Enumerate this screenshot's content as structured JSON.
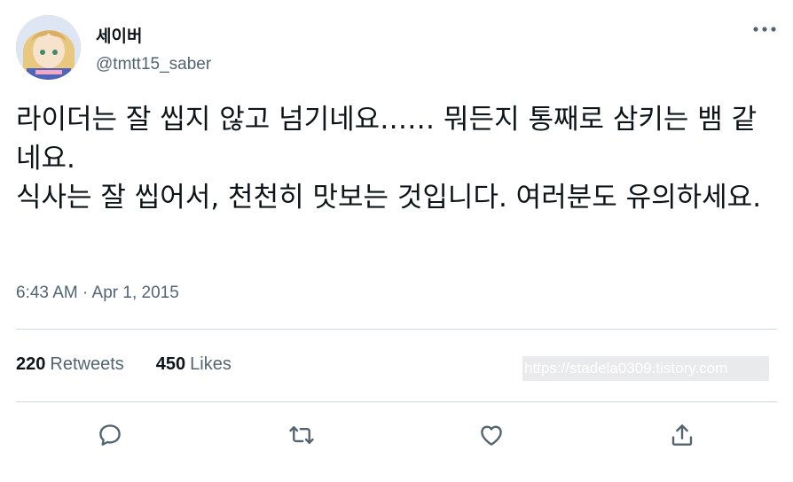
{
  "author": {
    "display_name": "세이버",
    "handle": "@tmtt15_saber"
  },
  "tweet": {
    "text": "라이더는 잘 씹지 않고 넘기네요…… 뭐든지 통째로 삼키는 뱀 같네요.\n식사는 잘 씹어서, 천천히 맛보는 것입니다. 여러분도 유의하세요.",
    "timestamp": "6:43 AM · Apr 1, 2015"
  },
  "stats": {
    "retweets_count": "220",
    "retweets_label": "Retweets",
    "likes_count": "450",
    "likes_label": "Likes"
  },
  "watermark": "https://stadela0309.tistory.com",
  "icons": {
    "more": "more-icon",
    "reply": "reply-icon",
    "retweet": "retweet-icon",
    "like": "like-icon",
    "share": "share-icon"
  },
  "colors": {
    "primary_text": "#0f1419",
    "secondary_text": "#536471",
    "divider": "#cfd9de"
  }
}
